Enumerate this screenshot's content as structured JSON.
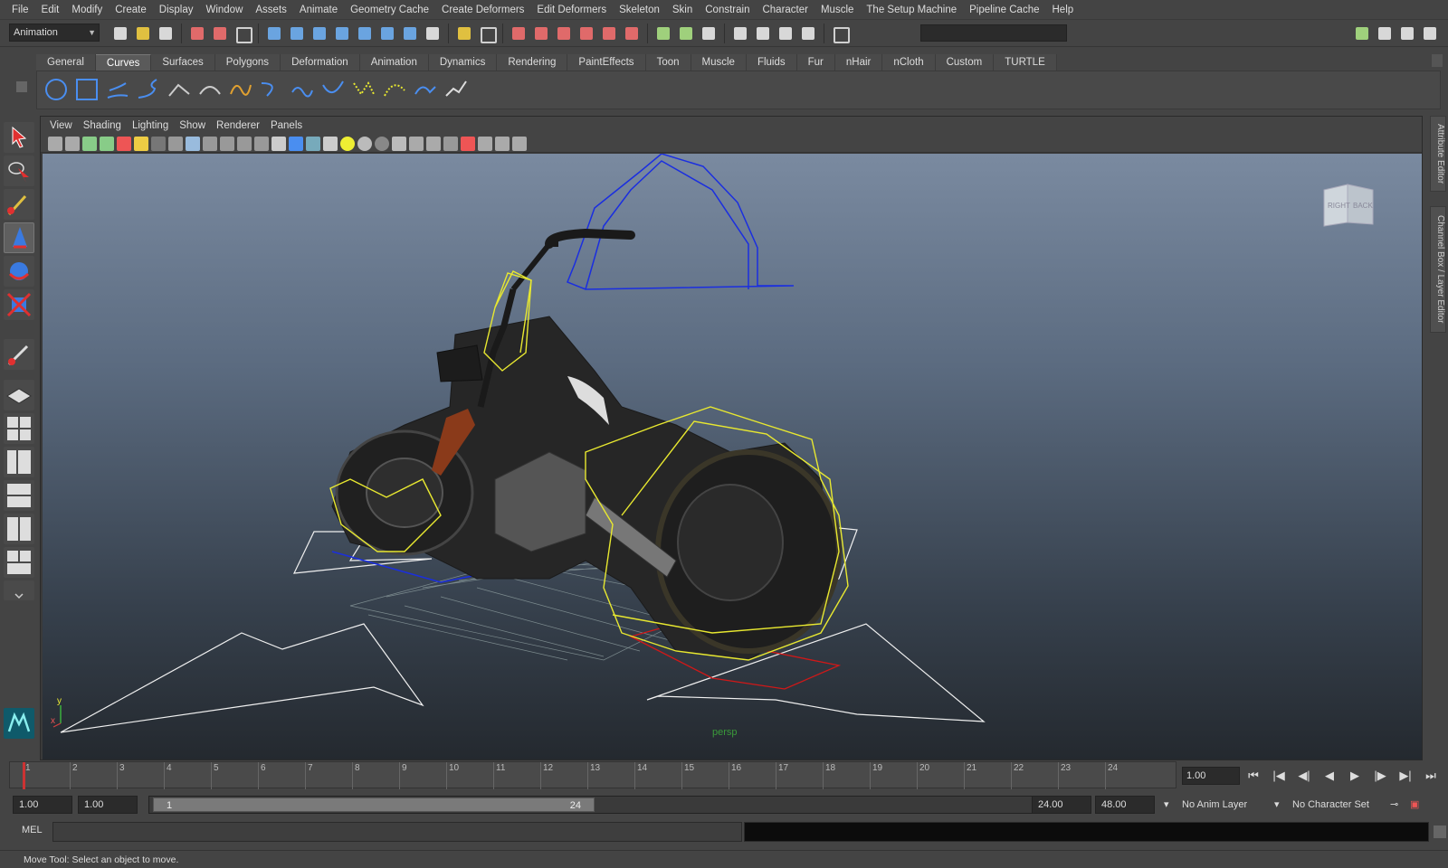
{
  "menubar": [
    "File",
    "Edit",
    "Modify",
    "Create",
    "Display",
    "Window",
    "Assets",
    "Animate",
    "Geometry Cache",
    "Create Deformers",
    "Edit Deformers",
    "Skeleton",
    "Skin",
    "Constrain",
    "Character",
    "Muscle",
    "The Setup Machine",
    "Pipeline Cache",
    "Help"
  ],
  "statusline": {
    "mode": "Animation"
  },
  "shelf": {
    "tabs": [
      "General",
      "Curves",
      "Surfaces",
      "Polygons",
      "Deformation",
      "Animation",
      "Dynamics",
      "Rendering",
      "PaintEffects",
      "Toon",
      "Muscle",
      "Fluids",
      "Fur",
      "nHair",
      "nCloth",
      "Custom",
      "TURTLE"
    ],
    "active_tab": "Curves"
  },
  "panel": {
    "menus": [
      "View",
      "Shading",
      "Lighting",
      "Show",
      "Renderer",
      "Panels"
    ],
    "camera": "persp",
    "viewcube": {
      "left": "RIGHT",
      "right": "BACK"
    },
    "axis": {
      "y": "y",
      "x": "x"
    }
  },
  "rightbar": {
    "tabs": [
      "Attribute Editor",
      "Channel Box / Layer Editor"
    ]
  },
  "timeline": {
    "ticks": [
      "1",
      "2",
      "3",
      "4",
      "5",
      "6",
      "7",
      "8",
      "9",
      "10",
      "11",
      "12",
      "13",
      "14",
      "15",
      "16",
      "17",
      "18",
      "19",
      "20",
      "21",
      "22",
      "23",
      "24"
    ],
    "current_frame": "1.00"
  },
  "range": {
    "start": "1.00",
    "playback_start": "1.00",
    "handle_start": "1",
    "handle_end": "24",
    "playback_end": "24.00",
    "end": "48.00",
    "anim_layer": "No Anim Layer",
    "character_set": "No Character Set"
  },
  "cmdline": {
    "label": "MEL"
  },
  "helpline": {
    "text": "Move Tool: Select an object to move."
  },
  "colors": {
    "accent": "#5a5a5a",
    "curve_blue": "#1a2ee0",
    "curve_yellow": "#e8e830",
    "curve_red": "#d01818"
  }
}
